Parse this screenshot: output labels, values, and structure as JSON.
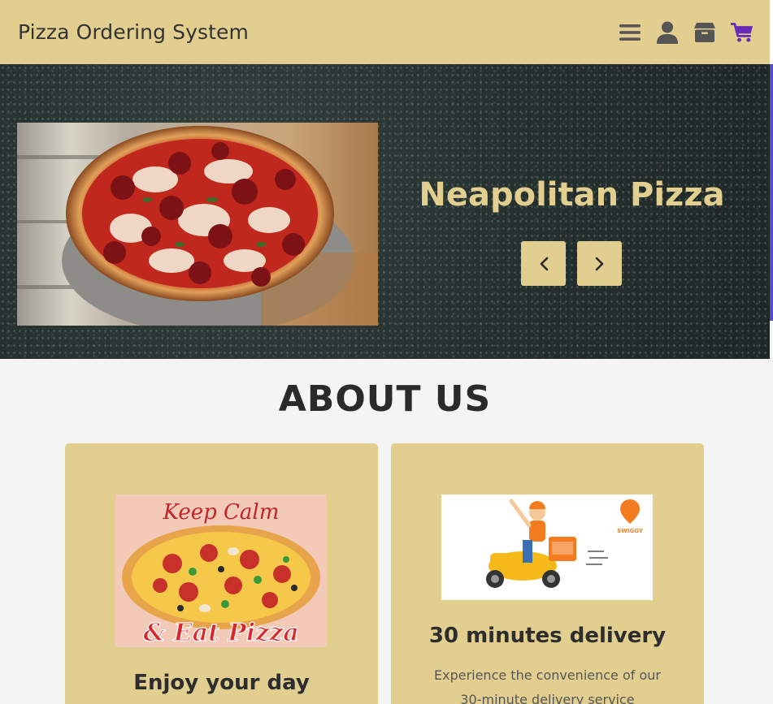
{
  "header": {
    "brand": "Pizza Ordering System",
    "icons": [
      "menu-icon",
      "user-icon",
      "box-icon",
      "cart-icon"
    ],
    "bg_color": "#e2cf8f",
    "cart_color": "#6a2ab8"
  },
  "hero": {
    "title": "Neapolitan Pizza",
    "image": "pepperoni-pizza-photo",
    "prev_icon": "chevron-left-icon",
    "next_icon": "chevron-right-icon"
  },
  "about": {
    "title": "ABOUT US",
    "cards": [
      {
        "image": "keep-calm-pizza-illustration",
        "image_text_top": "Keep Calm",
        "image_text_bottom": "& Eat Pizza",
        "title": "Enjoy your day",
        "text": ""
      },
      {
        "image": "swiggy-delivery-scooter-illustration",
        "image_badge": "SWIGGY",
        "title": "30 minutes delivery",
        "text": "Experience the convenience of our 30-minute delivery service"
      }
    ]
  }
}
